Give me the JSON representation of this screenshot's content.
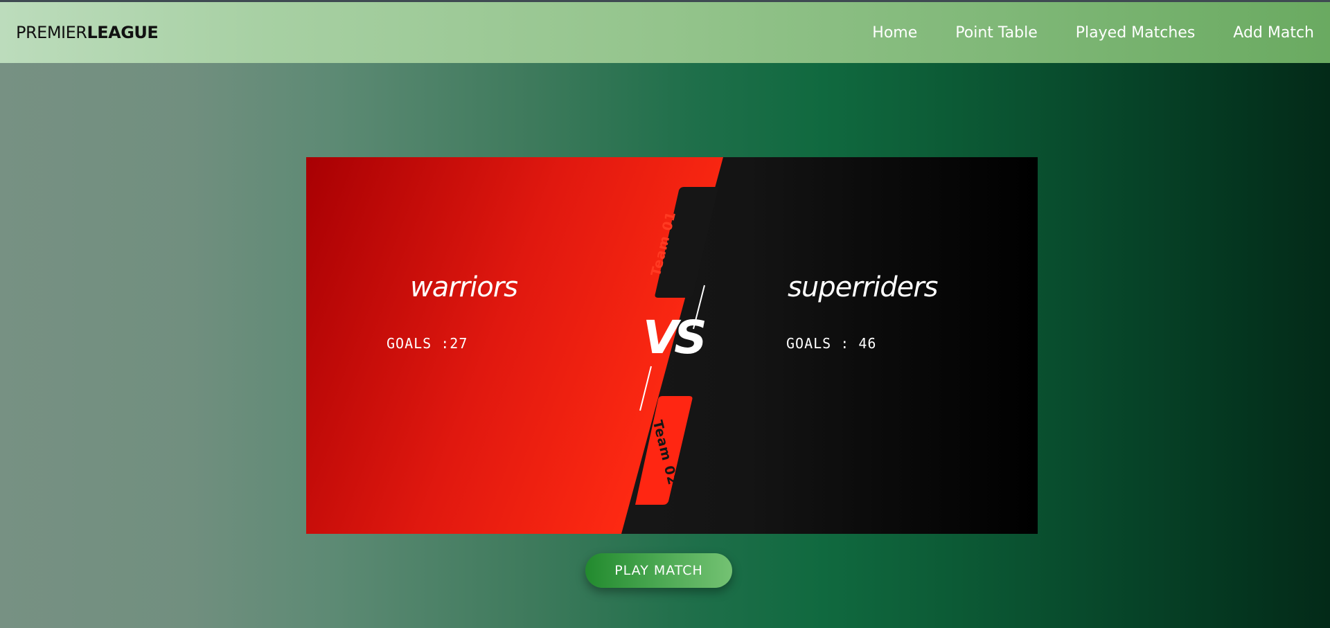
{
  "brand": {
    "light": "PREMIER",
    "bold": "LEAGUE"
  },
  "nav": {
    "items": [
      {
        "label": "Home"
      },
      {
        "label": "Point Table"
      },
      {
        "label": "Played Matches"
      },
      {
        "label": "Add Match"
      }
    ]
  },
  "match": {
    "team1": {
      "name": "warriors",
      "goals": "GOALS :27",
      "tag": "Team 01"
    },
    "team2": {
      "name": "superriders",
      "goals": "GOALS : 46",
      "tag": "Team 02"
    },
    "vs": "VS"
  },
  "actions": {
    "play_label": "PLAY MATCH"
  },
  "colors": {
    "red": "#e41b10",
    "black": "#141414",
    "green_button": "#3a9b43"
  }
}
